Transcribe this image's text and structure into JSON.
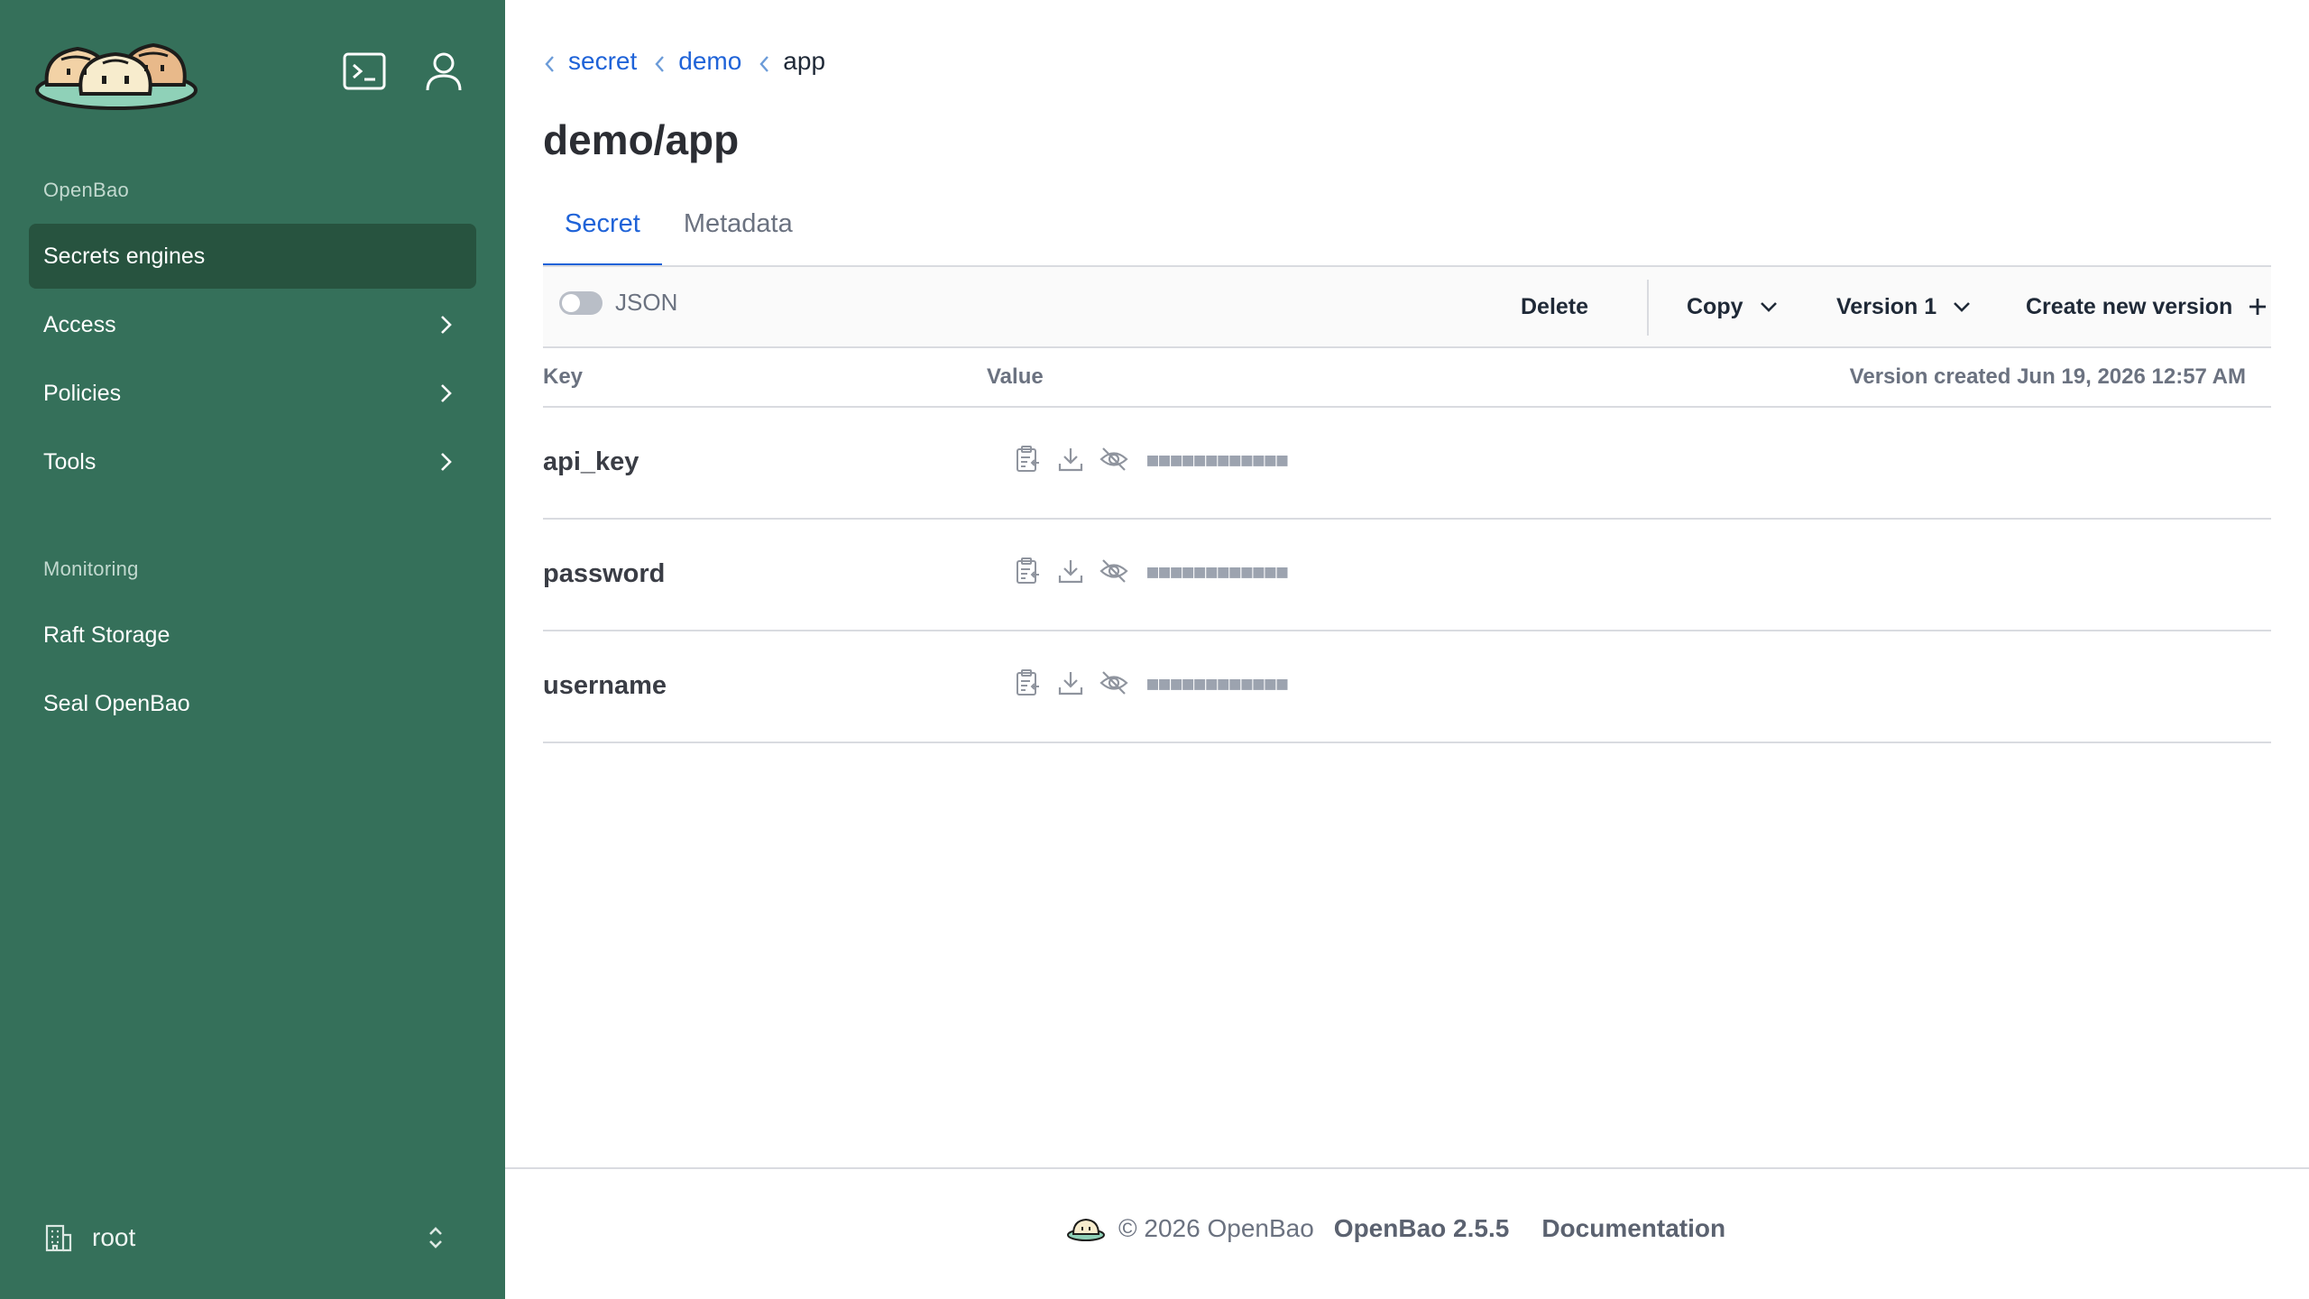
{
  "app": {
    "name": "OpenBao"
  },
  "sidebar": {
    "logo_alt": "OpenBao logo",
    "top_icons": [
      "terminal-icon",
      "user-icon"
    ],
    "sections": [
      {
        "label": "OpenBao",
        "items": [
          {
            "label": "Secrets engines",
            "active": true,
            "chevron": false
          },
          {
            "label": "Access",
            "active": false,
            "chevron": true
          },
          {
            "label": "Policies",
            "active": false,
            "chevron": true
          },
          {
            "label": "Tools",
            "active": false,
            "chevron": true
          }
        ]
      },
      {
        "label": "Monitoring",
        "items": [
          {
            "label": "Raft Storage",
            "active": false,
            "chevron": false
          },
          {
            "label": "Seal OpenBao",
            "active": false,
            "chevron": false
          }
        ]
      }
    ],
    "namespace": {
      "label": "root",
      "icon": "building-icon"
    },
    "colors": {
      "background": "#35705a",
      "active_item": "#27533f"
    }
  },
  "breadcrumb": [
    {
      "label": "secret",
      "link": true
    },
    {
      "label": "demo",
      "link": true
    },
    {
      "label": "app",
      "link": false
    }
  ],
  "page": {
    "title": "demo/app"
  },
  "tabs": [
    {
      "label": "Secret",
      "active": true
    },
    {
      "label": "Metadata",
      "active": false
    }
  ],
  "toolbar": {
    "json_toggle_label": "JSON",
    "json_toggle_on": false,
    "delete_label": "Delete",
    "copy_label": "Copy",
    "version_label": "Version 1",
    "create_label": "Create new version"
  },
  "table": {
    "headers": {
      "key": "Key",
      "value": "Value"
    },
    "version_created": "Version created Jun 19, 2026 12:57 AM",
    "rows": [
      {
        "key": "api_key",
        "masked_value": "■■■■■■■■■■■■",
        "icons": [
          "clipboard-icon",
          "download-icon",
          "eye-off-icon"
        ]
      },
      {
        "key": "password",
        "masked_value": "■■■■■■■■■■■■",
        "icons": [
          "clipboard-icon",
          "download-icon",
          "eye-off-icon"
        ]
      },
      {
        "key": "username",
        "masked_value": "■■■■■■■■■■■■",
        "icons": [
          "clipboard-icon",
          "download-icon",
          "eye-off-icon"
        ]
      }
    ]
  },
  "footer": {
    "copyright": "© 2026 OpenBao",
    "version": "OpenBao 2.5.5",
    "docs_label": "Documentation"
  },
  "colors": {
    "accent": "#1f63d8",
    "border": "#d9dbe0"
  }
}
